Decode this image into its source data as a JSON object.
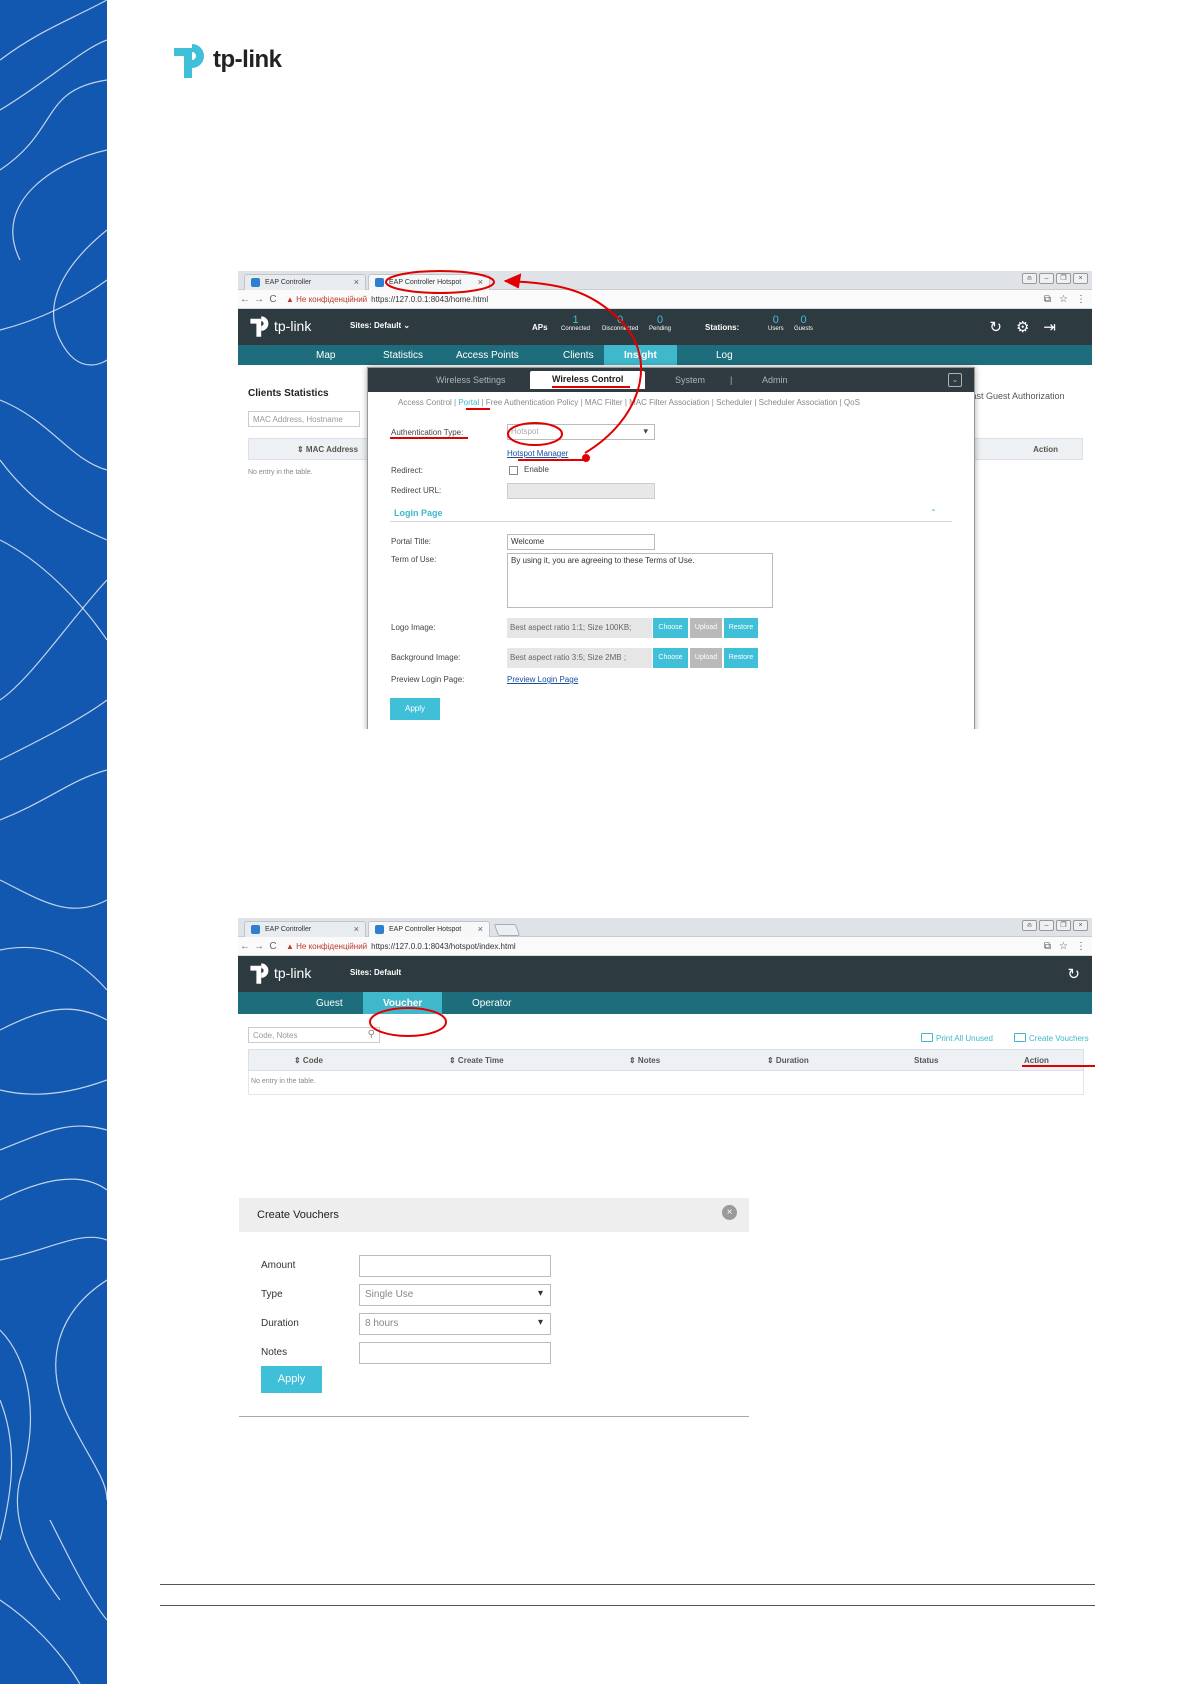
{
  "colors": {
    "brand_blue": "#1257b0",
    "header_dark": "#2d3a40",
    "nav_teal": "#1d6d7c",
    "accent_cyan": "#3fc0d8",
    "annotation_red": "#e00000"
  },
  "logo": {
    "text": "tp-link"
  },
  "shot1": {
    "tabs": [
      {
        "label": "EAP Controller",
        "close": "×"
      },
      {
        "label": "EAP Controller Hotspot",
        "close": "×"
      }
    ],
    "url": {
      "warning": "▲ Не конфіденційний",
      "address": "https://127.0.0.1:8043/home.html"
    },
    "header": {
      "logo": "tp-link",
      "sites": "Sites: Default ⌄",
      "aps_label": "APs",
      "aps": [
        {
          "value": "1",
          "label": "Connected"
        },
        {
          "value": "0",
          "label": "Disconnected"
        },
        {
          "value": "0",
          "label": "Pending"
        }
      ],
      "stations_label": "Stations:",
      "stations": [
        {
          "value": "0",
          "label": "Users"
        },
        {
          "value": "0",
          "label": "Guests"
        }
      ]
    },
    "nav": [
      "Map",
      "Statistics",
      "Access Points",
      "Clients",
      "Insight",
      "Log"
    ],
    "page": {
      "title": "Clients Statistics",
      "search_placeholder": "MAC Address, Hostname",
      "col_mac": "⇕ MAC Address",
      "col_action": "Action",
      "empty": "No entry in the table.",
      "right_link": "Fast Guest Authorization"
    },
    "modal": {
      "tabs": [
        "Wireless Settings",
        "Wireless Control",
        "System",
        "Admin"
      ],
      "separators": [
        "|",
        "|"
      ],
      "close": "⌄",
      "subnav": {
        "before": "Access Control",
        "active": "Portal",
        "after": "Free Authentication Policy | MAC Filter | MAC Filter Association | Scheduler | Scheduler Association | QoS",
        "sep": "|"
      },
      "auth_type_label": "Authentication Type:",
      "auth_type_value": "Hotspot",
      "hotspot_manager": "Hotspot Manager",
      "redirect_label": "Redirect:",
      "redirect_enable": "Enable",
      "redirect_url_label": "Redirect URL:",
      "login_page": "Login Page",
      "collapse": "⌃",
      "portal_title_label": "Portal Title:",
      "portal_title_value": "Welcome",
      "terms_label": "Term of Use:",
      "terms_value": "By using it, you are agreeing to these Terms of Use.",
      "logo_label": "Logo Image:",
      "logo_hint": "Best aspect ratio 1:1; Size 100KB;",
      "bg_label": "Background Image:",
      "bg_hint": "Best aspect ratio 3:5; Size 2MB ;",
      "choose": "Choose",
      "upload": "Upload",
      "restore": "Restore",
      "preview_label": "Preview Login Page:",
      "preview_link": "Preview Login Page",
      "apply": "Apply"
    }
  },
  "shot2": {
    "tabs": [
      {
        "label": "EAP Controller",
        "close": "×"
      },
      {
        "label": "EAP Controller Hotspot",
        "close": "×"
      }
    ],
    "url": {
      "warning": "▲ Не конфіденційний",
      "address": "https://127.0.0.1:8043/hotspot/index.html"
    },
    "header": {
      "logo": "tp-link",
      "sites": "Sites: Default"
    },
    "nav": [
      "Guest",
      "Voucher",
      "Operator"
    ],
    "search_placeholder": "Code, Notes",
    "print_all": "Print All Unused",
    "create_vouchers": "Create Vouchers",
    "columns": [
      "⇕ Code",
      "⇕ Create Time",
      "⇕ Notes",
      "⇕ Duration",
      "Status",
      "Action"
    ],
    "empty": "No entry in the table."
  },
  "dialog": {
    "title": "Create Vouchers",
    "close": "×",
    "amount_label": "Amount",
    "amount_value": "",
    "type_label": "Type",
    "type_value": "Single Use",
    "duration_label": "Duration",
    "duration_value": "8 hours",
    "notes_label": "Notes",
    "notes_value": "",
    "apply": "Apply"
  }
}
